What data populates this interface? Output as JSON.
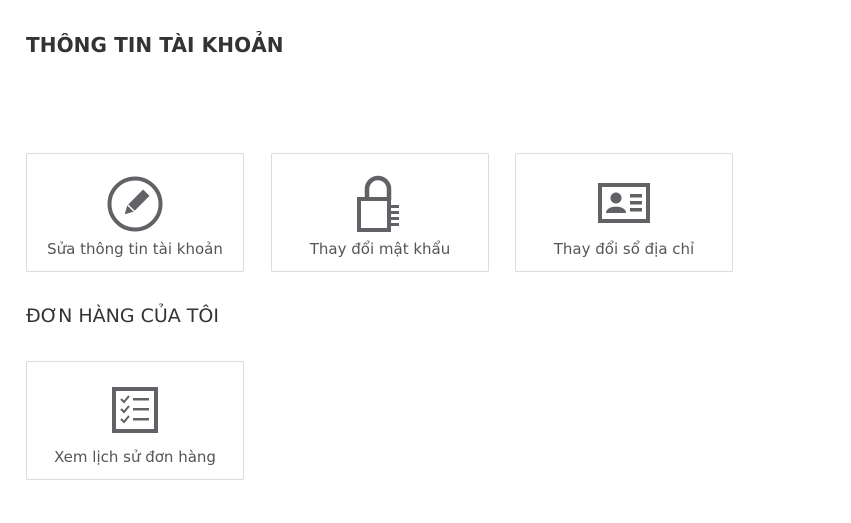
{
  "account": {
    "title": "THÔNG TIN TÀI KHOẢN",
    "cards": [
      {
        "label": "Sửa thông tin tài khoản",
        "icon": "pencil-circle-icon"
      },
      {
        "label": "Thay đổi mật khẩu",
        "icon": "padlock-icon"
      },
      {
        "label": "Thay đổi sổ địa chỉ",
        "icon": "address-card-icon"
      }
    ]
  },
  "orders": {
    "title": "ĐƠN HÀNG CỦA TÔI",
    "cards": [
      {
        "label": "Xem lịch sử đơn hàng",
        "icon": "checklist-icon"
      }
    ]
  },
  "colors": {
    "icon": "#616166",
    "text": "#333333",
    "label": "#555555",
    "border": "#dcdcdc"
  }
}
